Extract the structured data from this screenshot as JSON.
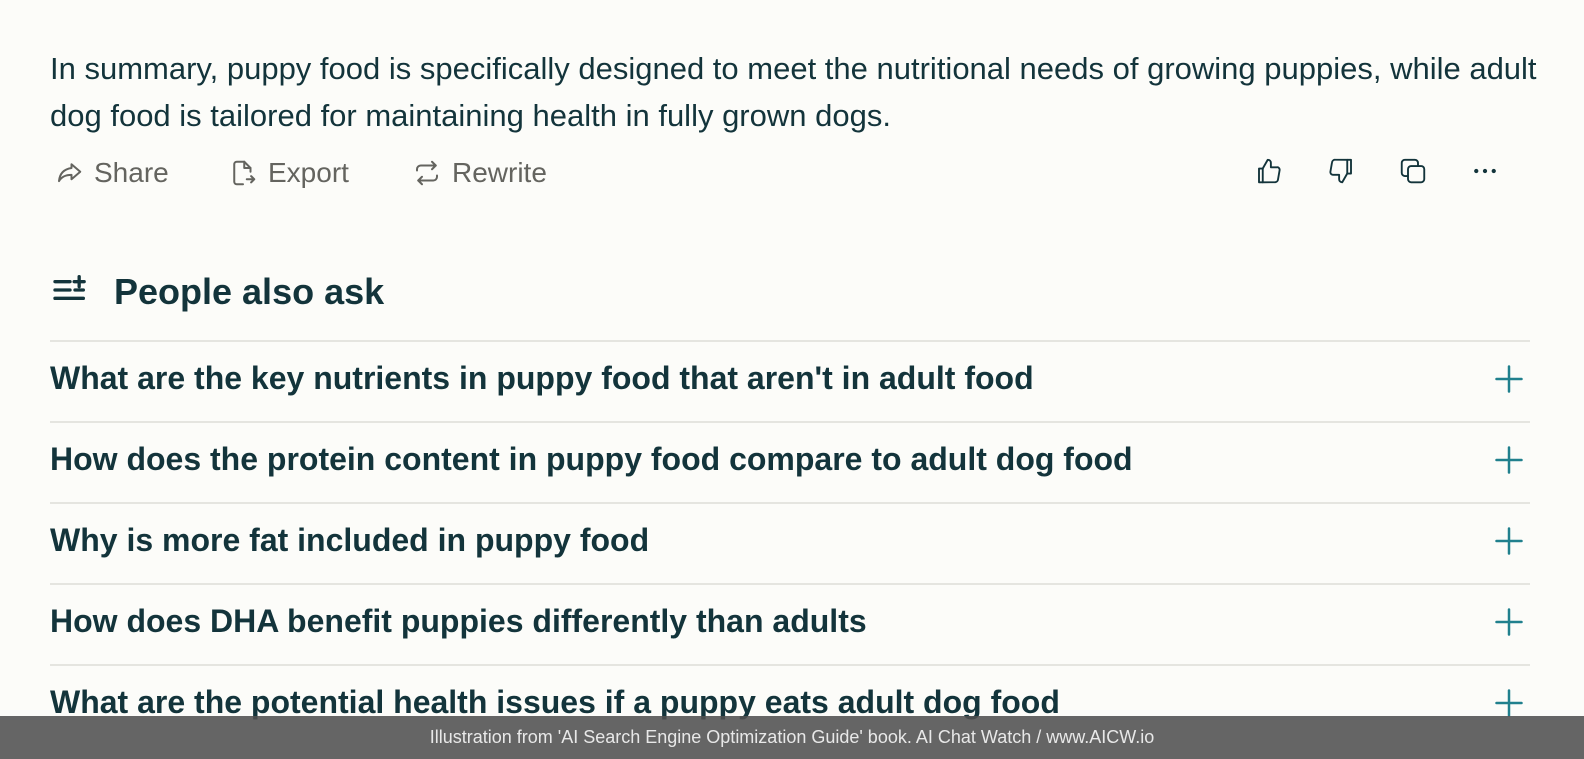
{
  "answer": {
    "summary": "In summary, puppy food is specifically designed to meet the nutritional needs of growing puppies, while adult dog food is tailored for maintaining health in fully grown dogs."
  },
  "actions": {
    "share_label": "Share",
    "export_label": "Export",
    "rewrite_label": "Rewrite",
    "icons": [
      "share-icon",
      "export-icon",
      "rewrite-icon",
      "thumbs-up-icon",
      "thumbs-down-icon",
      "copy-icon",
      "more-icon"
    ]
  },
  "related": {
    "title": "People also ask",
    "header_icon": "list-plus-icon",
    "items": [
      {
        "question": "What are the key nutrients in puppy food that aren't in adult food"
      },
      {
        "question": "How does the protein content in puppy food compare to adult dog food"
      },
      {
        "question": "Why is more fat included in puppy food"
      },
      {
        "question": "How does DHA benefit puppies differently than adults"
      },
      {
        "question": "What are the potential health issues if a puppy eats adult dog food"
      }
    ]
  },
  "footer": {
    "caption": "Illustration from 'AI Search Engine Optimization Guide' book. AI Chat Watch / www.AICW.io"
  },
  "colors": {
    "background": "#fcfcf9",
    "text": "#13343b",
    "muted": "#64645f",
    "accent": "#20808d",
    "divider": "#e5e5e0"
  }
}
